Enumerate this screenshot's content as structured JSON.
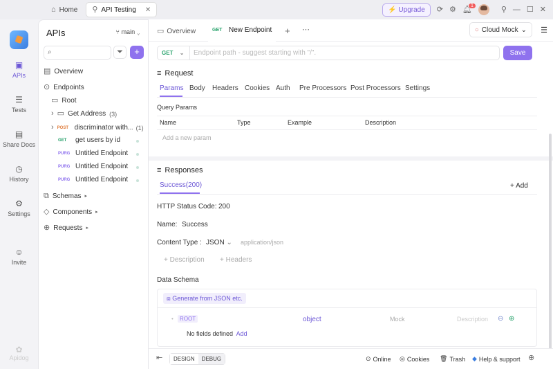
{
  "titlebar": {
    "tabs": [
      {
        "label": "Home",
        "icon": "home-icon"
      },
      {
        "label": "API Testing",
        "icon": "api-icon"
      }
    ],
    "upgrade_label": "Upgrade",
    "notification_count": "1"
  },
  "rail": {
    "items": [
      {
        "label": "APIs",
        "icon": "apis-icon"
      },
      {
        "label": "Tests",
        "icon": "tests-icon"
      },
      {
        "label": "Share Docs",
        "icon": "book-icon"
      },
      {
        "label": "History",
        "icon": "clock-icon"
      },
      {
        "label": "Settings",
        "icon": "gear-icon"
      },
      {
        "label": "Invite",
        "icon": "invite-icon"
      }
    ],
    "brand": "Apidog"
  },
  "sidebar": {
    "title": "APIs",
    "branch": "main",
    "overview": "Overview",
    "endpoints": "Endpoints",
    "root": "Root",
    "folder": {
      "label": "Get Address",
      "count": "(3)"
    },
    "items": [
      {
        "method": "POST",
        "label": "discriminator with...",
        "count": "(1)"
      },
      {
        "method": "GET",
        "label": "get users by id"
      },
      {
        "method": "PURG",
        "label": "Untitled Endpoint"
      },
      {
        "method": "PURG",
        "label": "Untitled Endpoint"
      },
      {
        "method": "PURG",
        "label": "Untitled Endpoint"
      }
    ],
    "schemas": "Schemas",
    "components": "Components",
    "requests": "Requests"
  },
  "main": {
    "tab_overview": "Overview",
    "tab_new_method": "GET",
    "tab_new_label": "New Endpoint",
    "env": "Cloud Mock",
    "url_method": "GET",
    "url_placeholder": "Endpoint path - suggest starting with \"/\".",
    "save_label": "Save",
    "request_title": "Request",
    "request_tabs": [
      "Params",
      "Body",
      "Headers",
      "Cookies",
      "Auth",
      "Pre Processors",
      "Post Processors",
      "Settings"
    ],
    "query_params": "Query Params",
    "columns": [
      "Name",
      "Type",
      "Example",
      "Description"
    ],
    "add_param": "Add a new param",
    "responses_title": "Responses",
    "response_tab": "Success(200)",
    "add_label": "Add",
    "status_label": "HTTP Status Code:",
    "status_value": "200",
    "name_label": "Name:",
    "name_value": "Success",
    "content_type_label": "Content Type :",
    "content_type_value": "JSON",
    "content_type_hint": "application/json",
    "add_description": "Description",
    "add_headers": "Headers",
    "data_schema": "Data Schema",
    "generate_label": "Generate from JSON etc.",
    "root_label": "ROOT",
    "root_type": "object",
    "mock_label": "Mock",
    "description_placeholder": "Description",
    "no_fields": "No fields defined",
    "add_link": "Add"
  },
  "bottombar": {
    "design": "DESIGN",
    "debug": "DEBUG",
    "online": "Online",
    "cookies": "Cookies",
    "trash": "Trash",
    "help": "Help & support"
  },
  "colors": {
    "accent": "#8f72ee",
    "get": "#27a26b",
    "post": "#e07b39"
  }
}
